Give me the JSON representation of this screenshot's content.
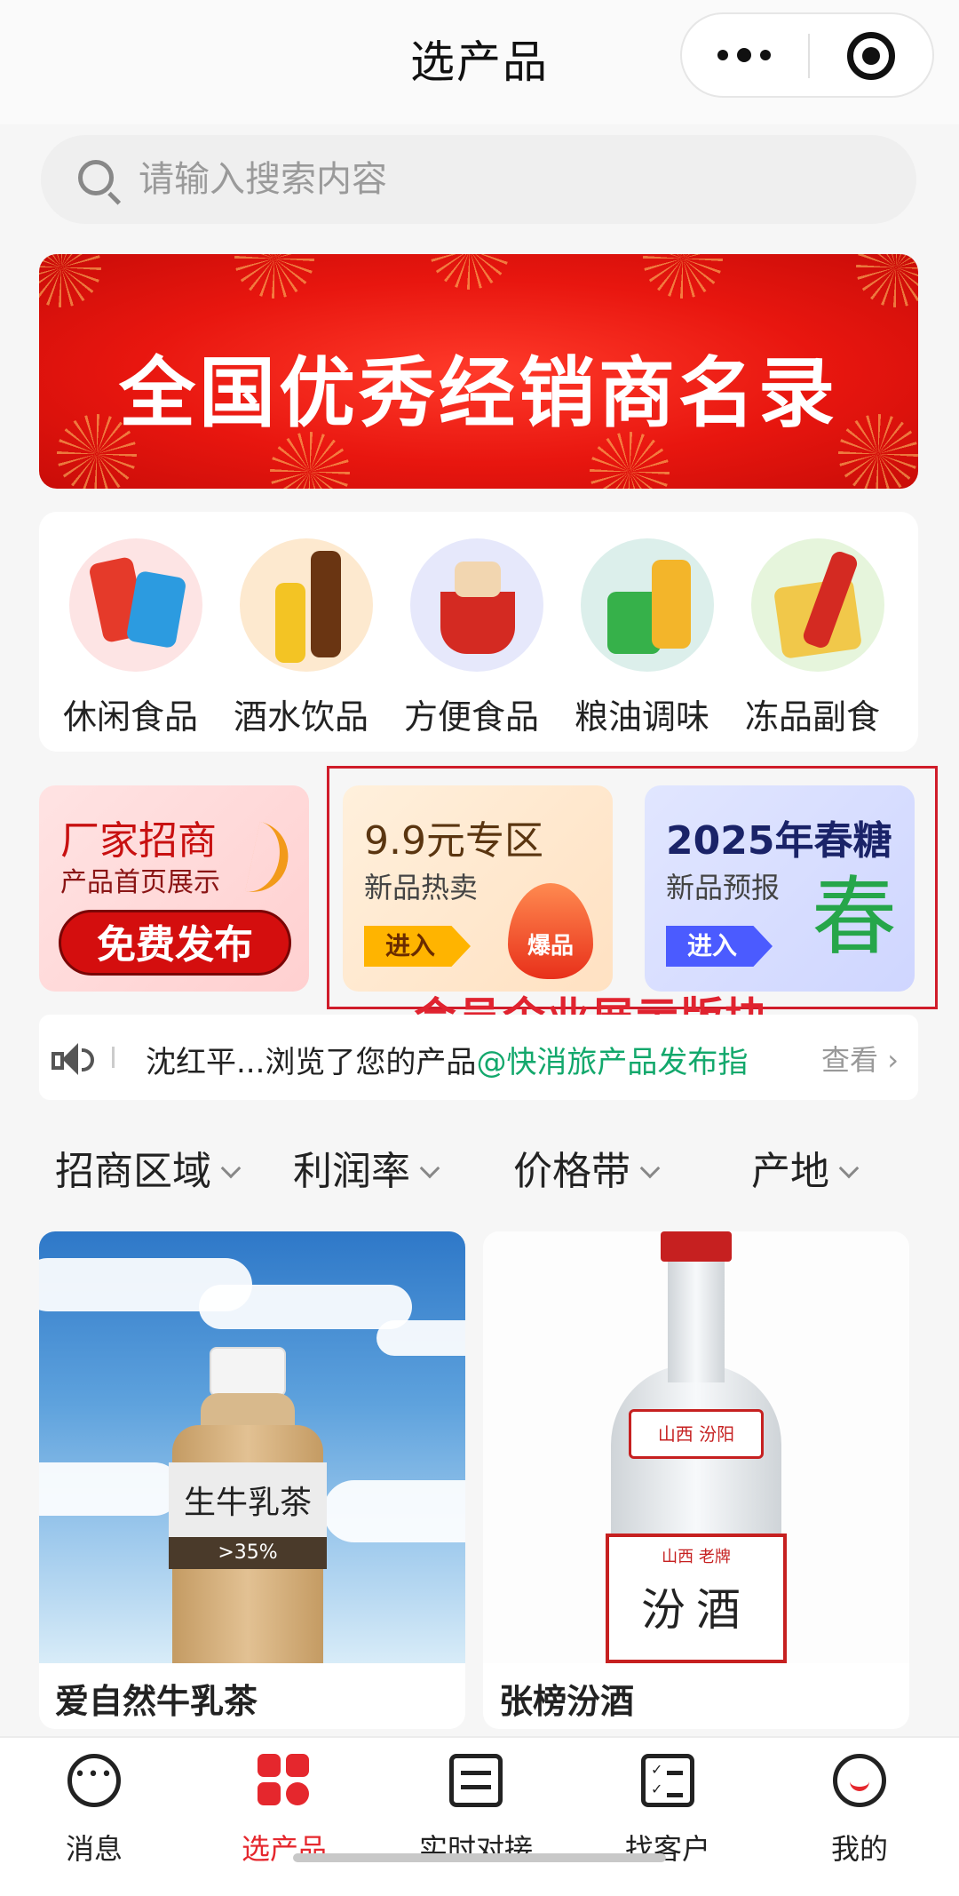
{
  "header": {
    "title": "选产品",
    "more_icon": "more-dots-icon",
    "close_icon": "target-icon"
  },
  "search": {
    "placeholder": "请输入搜索内容",
    "icon": "search-icon"
  },
  "banner": {
    "text": "全国优秀经销商名录",
    "color": "#e8160f"
  },
  "categories": [
    {
      "label": "休闲食品",
      "bg": "#fde4e4"
    },
    {
      "label": "酒水饮品",
      "bg": "#fde9cf"
    },
    {
      "label": "方便食品",
      "bg": "#e6e8fb"
    },
    {
      "label": "粮油调味",
      "bg": "#dcefeb"
    },
    {
      "label": "冻品副食",
      "bg": "#e6f5dc"
    }
  ],
  "promos": {
    "recruit": {
      "title": "厂家招商",
      "subtitle": "产品首页展示",
      "button": "免费发布"
    },
    "deal": {
      "title": "9.9元专区",
      "subtitle": "新品热卖",
      "enter": "进入",
      "badge": "爆品"
    },
    "spring": {
      "title": "2025年春糖",
      "subtitle": "新品预报",
      "enter": "进入",
      "glyph": "春"
    }
  },
  "member_section_label": "会员企业展示版块",
  "notice": {
    "icon": "speaker-icon",
    "text": "沈红平...浏览了您的产品",
    "link": "@快消旅产品发布指",
    "view": "查看"
  },
  "filters": [
    {
      "label": "招商区域"
    },
    {
      "label": "利润率"
    },
    {
      "label": "价格带"
    },
    {
      "label": "产地"
    }
  ],
  "products": [
    {
      "name": "爱自然牛乳茶",
      "label_text": "生牛乳茶",
      "strip_text": ">35%"
    },
    {
      "name": "张榜汾酒",
      "tag_text": "山西 汾阳",
      "label_small": "山西 老牌",
      "label_big": "汾酒"
    }
  ],
  "tabs": [
    {
      "label": "消息",
      "icon": "message-icon",
      "active": false
    },
    {
      "label": "选产品",
      "icon": "grid-icon",
      "active": true
    },
    {
      "label": "实时对接",
      "icon": "sliders-icon",
      "active": false
    },
    {
      "label": "找客户",
      "icon": "checklist-icon",
      "active": false
    },
    {
      "label": "我的",
      "icon": "profile-icon",
      "active": false
    }
  ],
  "colors": {
    "accent": "#e5272d",
    "link_green": "#13a86c"
  }
}
